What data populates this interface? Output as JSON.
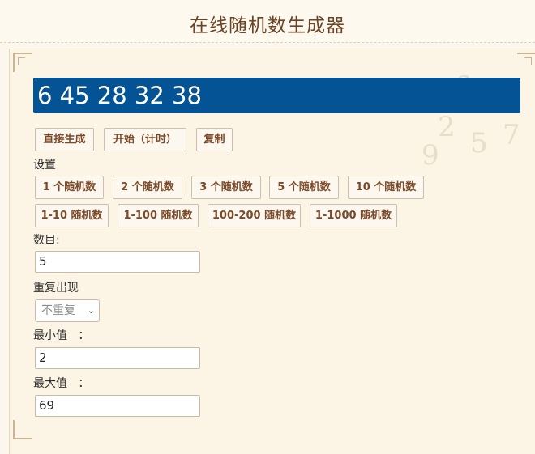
{
  "header": {
    "title": "在线随机数生成器"
  },
  "result": {
    "text": "6 45 28 32 38"
  },
  "actions": {
    "generate": "直接生成",
    "start_timer": "开始（计时）",
    "copy": "复制"
  },
  "settings": {
    "label": "设置",
    "presets_count": [
      "1 个随机数",
      "2 个随机数",
      "3 个随机数",
      "5 个随机数",
      "10 个随机数"
    ],
    "presets_range": [
      "1-10 随机数",
      "1-100 随机数",
      "100-200 随机数",
      "1-1000 随机数"
    ]
  },
  "form": {
    "count_label": "数目:",
    "count_value": "5",
    "repeat_label": "重复出现",
    "repeat_selected": "不重复",
    "min_label": "最小值   ：",
    "min_value": "2",
    "max_label": "最大值   ：",
    "max_value": "69"
  }
}
